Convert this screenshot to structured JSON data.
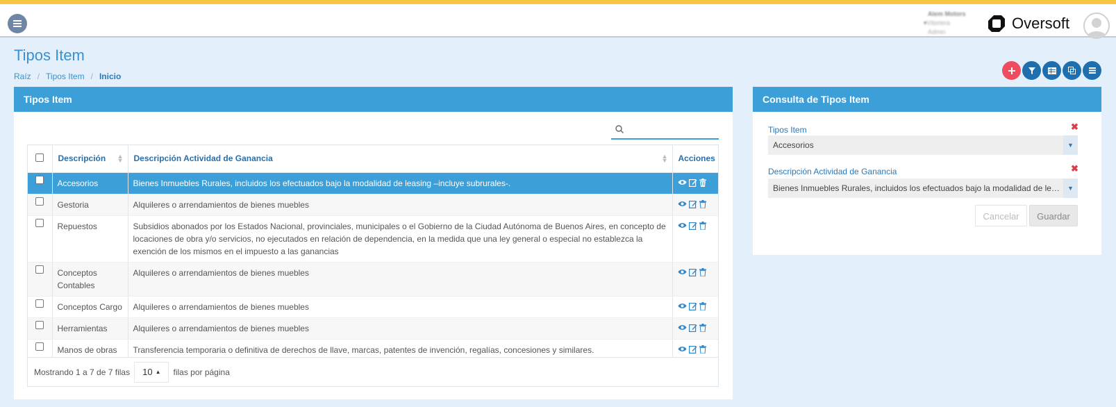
{
  "header": {
    "user_name": "Alem Motors",
    "user_company": "Vitoriera",
    "user_role": "Admin",
    "brand_name": "Oversoft"
  },
  "page": {
    "title": "Tipos Item",
    "breadcrumb": [
      "Raíz",
      "Tipos Item",
      "Inicio"
    ]
  },
  "actions": [
    {
      "icon": "plus-icon",
      "color": "#ee4d5f"
    },
    {
      "icon": "filter-icon",
      "color": "#1f6fae"
    },
    {
      "icon": "grid-icon",
      "color": "#1f6fae"
    },
    {
      "icon": "copy-icon",
      "color": "#1f6fae"
    },
    {
      "icon": "list-icon",
      "color": "#1f6fae"
    }
  ],
  "list_panel": {
    "title": "Tipos Item",
    "search_placeholder": "",
    "columns": [
      "Descripción",
      "Descripción Actividad de Ganancia",
      "Acciones"
    ],
    "rows": [
      {
        "descripcion": "Accesorios",
        "actividad": "Bienes Inmuebles Rurales, incluidos los efectuados bajo la modalidad de leasing –incluye subrurales-.",
        "selected": true
      },
      {
        "descripcion": "Gestoria",
        "actividad": "Alquileres o arrendamientos de bienes muebles",
        "selected": false
      },
      {
        "descripcion": "Repuestos",
        "actividad": "Subsidios abonados por los Estados Nacional, provinciales, municipales o el Gobierno de la Ciudad Autónoma de Buenos Aires, en concepto de locaciones de obra y/o servicios, no ejecutados en relación de dependencia, en la medida que una ley general o especial no establezca la exención de los mismos en el impuesto a las ganancias",
        "selected": false
      },
      {
        "descripcion": "Conceptos Contables",
        "actividad": "Alquileres o arrendamientos de bienes muebles",
        "selected": false
      },
      {
        "descripcion": "Conceptos Cargo",
        "actividad": "Alquileres o arrendamientos de bienes muebles",
        "selected": false
      },
      {
        "descripcion": "Herramientas",
        "actividad": "Alquileres o arrendamientos de bienes muebles",
        "selected": false
      },
      {
        "descripcion": "Manos de obras",
        "actividad": "Transferencia temporaria o definitiva de derechos de llave, marcas, patentes de invención, regalías, concesiones y similares.",
        "selected": false
      }
    ],
    "footer": {
      "showing": "Mostrando 1 a 7 de 7 filas",
      "page_size": "10",
      "per_page": "filas por página"
    }
  },
  "query_panel": {
    "title": "Consulta de Tipos Item",
    "field1_label": "Tipos Item",
    "field1_value": "Accesorios",
    "field2_label": "Descripción Actividad de Ganancia",
    "field2_value": "Bienes Inmuebles Rurales, incluidos los efectuados bajo la modalidad de leasing",
    "clear_symbol": "✖",
    "cancel_label": "Cancelar",
    "save_label": "Guardar"
  },
  "colors": {
    "accent": "#3d9fd8",
    "header_stripe": "#f6c642",
    "action_dark": "#1f6fae",
    "action_red": "#ee4d5f"
  }
}
